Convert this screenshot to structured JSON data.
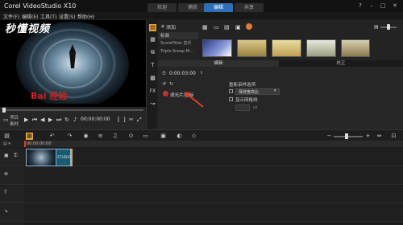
{
  "window": {
    "title": "Corel VideoStudio X10",
    "tabs": [
      {
        "label": "欢迎",
        "active": false
      },
      {
        "label": "捕获",
        "active": false
      },
      {
        "label": "编辑",
        "active": true
      },
      {
        "label": "共享",
        "active": false
      }
    ]
  },
  "menu": [
    "文件(F)",
    "编辑(E)",
    "工具(T)",
    "设置(S)",
    "帮助(H)"
  ],
  "preview": {
    "watermark": "秒懂视频",
    "overlay_text": "Bai 经验",
    "timecode": "00:00:00:00",
    "toggles": [
      "项目",
      "素材"
    ]
  },
  "library": {
    "add_label": "添加",
    "items": [
      "标准",
      "ScoreFitter 音乐",
      "Triple Scoop M..."
    ],
    "zoom_value": "50"
  },
  "options": {
    "tabs": [
      "编辑",
      "校正"
    ],
    "duration": "0:00:03:00",
    "effect_label": "重新采样选项",
    "resample_value": "保持宽高比",
    "checkbox_label": "显示网格线",
    "filter_label": "滤光片/图标",
    "annotation_color": "#e03a2a"
  },
  "timeline": {
    "ruler_start": "00:00:00:00",
    "clip_label": "STUDIO"
  },
  "colors": {
    "accent": "#2d6fb6",
    "bg": "#202020",
    "clip": "#1b5a73"
  }
}
